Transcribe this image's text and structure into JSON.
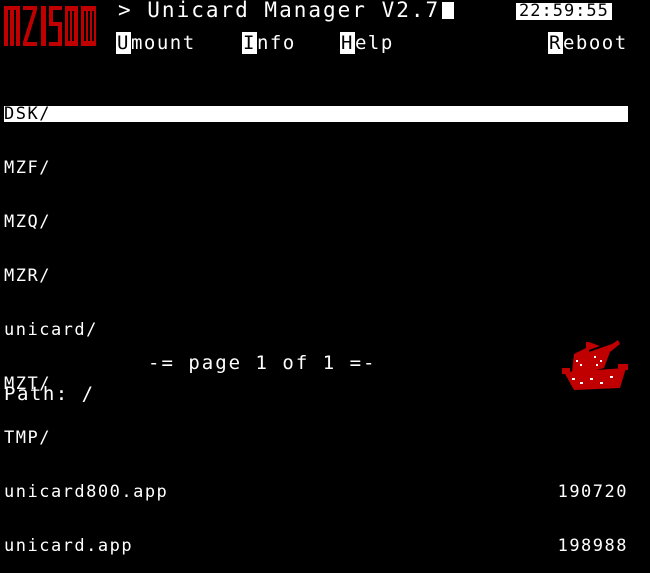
{
  "header": {
    "logo_text": "MZ1500",
    "title": "> Unicard Manager V2.7",
    "clock": "22:59:55"
  },
  "menu": [
    {
      "key": "U",
      "rest": "mount"
    },
    {
      "key": "I",
      "rest": "nfo"
    },
    {
      "key": "H",
      "rest": "elp"
    },
    {
      "key": "R",
      "rest": "eboot"
    }
  ],
  "files": [
    {
      "name": "DSK/",
      "size": "",
      "selected": true
    },
    {
      "name": "MZF/",
      "size": ""
    },
    {
      "name": "MZQ/",
      "size": ""
    },
    {
      "name": "MZR/",
      "size": ""
    },
    {
      "name": "unicard/",
      "size": ""
    },
    {
      "name": "MZT/",
      "size": ""
    },
    {
      "name": "TMP/",
      "size": ""
    },
    {
      "name": "unicard800.app",
      "size": "190720"
    },
    {
      "name": "unicard.app",
      "size": "198988"
    }
  ],
  "footer": {
    "pager": "-= page 1 of 1 =-",
    "path": "Path: /"
  },
  "colors": {
    "background": "#000000",
    "foreground": "#ffffff",
    "logo_red": "#c00000"
  }
}
